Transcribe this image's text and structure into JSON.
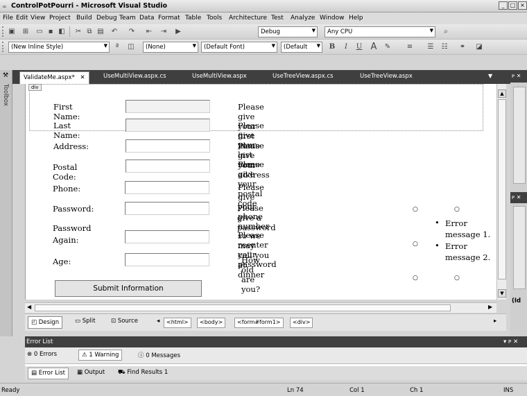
{
  "window": {
    "title": "ControlPotPourri - Microsoft Visual Studio"
  },
  "menu": [
    "File",
    "Edit",
    "View",
    "Project",
    "Build",
    "Debug",
    "Team",
    "Data",
    "Format",
    "Table",
    "Tools",
    "Architecture",
    "Test",
    "Analyze",
    "Window",
    "Help"
  ],
  "toolbar": {
    "config": "Debug",
    "platform": "Any CPU",
    "style": "(New Inline Style)",
    "block_format": "(None)",
    "font": "(Default Font)",
    "font_size": "(Default"
  },
  "toolbox_label": "Toolbox",
  "tabs": [
    {
      "label": "ValidateMe.aspx*"
    },
    {
      "label": "UseMultiView.aspx.cs"
    },
    {
      "label": "UseMultiView.aspx"
    },
    {
      "label": "UseTreeView.aspx.cs"
    },
    {
      "label": "UseTreeView.aspx"
    }
  ],
  "div_tag": "div",
  "form": {
    "rows": [
      {
        "label": "First Name:",
        "message": "Please give your first name"
      },
      {
        "label": "Last Name:",
        "message": "Please give your last name"
      },
      {
        "label": "Address:",
        "message": "Please give your address"
      },
      {
        "label": "Postal Code:",
        "message": "Please give your postal code"
      },
      {
        "label": "Phone:",
        "message": "Please give your phone number so we may call you at dinner"
      },
      {
        "label": "Password:",
        "message": "Please give a password"
      },
      {
        "label": "Password Again:",
        "message": "Please reenter your password"
      },
      {
        "label": "Age:",
        "message": "How old are you?"
      }
    ],
    "submit_label": "Submit Information",
    "summary": [
      "Error message 1.",
      "Error message 2."
    ]
  },
  "views": {
    "design": "Design",
    "split": "Split",
    "source": "Source",
    "breadcrumb": [
      "<html>",
      "<body>",
      "<form#form1>",
      "<div>"
    ]
  },
  "right_panel": {
    "id_label": "(Id"
  },
  "error_list": {
    "title": "Error List",
    "errors": "0 Errors",
    "warnings": "1 Warning",
    "messages": "0 Messages"
  },
  "bottom_tabs": [
    "Error List",
    "Output",
    "Find Results 1"
  ],
  "status": {
    "ready": "Ready",
    "ln": "Ln 74",
    "col": "Col 1",
    "ch": "Ch 1",
    "ins": "INS"
  }
}
